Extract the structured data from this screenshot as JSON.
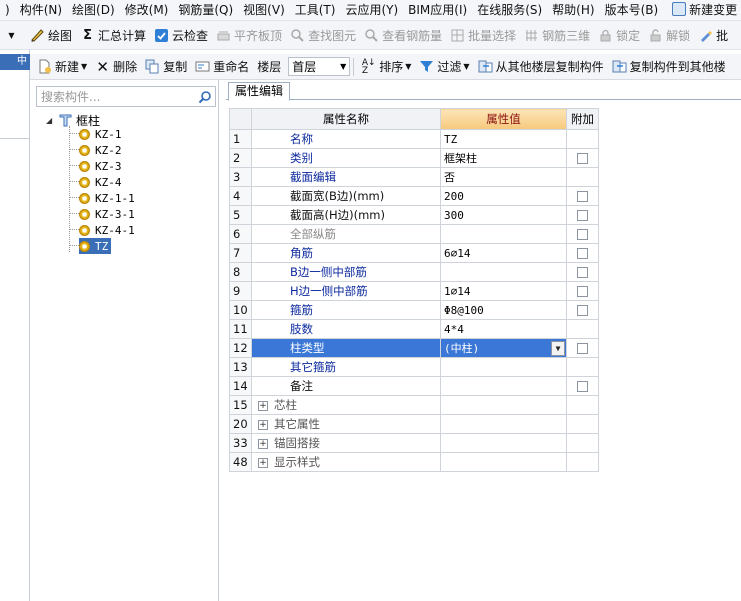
{
  "menubar": {
    "items": [
      ")",
      "构件(N)",
      "绘图(D)",
      "修改(M)",
      "钢筋量(Q)",
      "视图(V)",
      "工具(T)",
      "云应用(Y)",
      "BIM应用(I)",
      "在线服务(S)",
      "帮助(H)",
      "版本号(B)",
      "新建变更"
    ]
  },
  "toolbar1": {
    "draw": "绘图",
    "sum_calc": "汇总计算",
    "cloud_check": "云检查",
    "level_slab": "平齐板顶",
    "find_element": "查找图元",
    "view_rebar": "查看钢筋量",
    "batch_select": "批量选择",
    "rebar_3d": "钢筋三维",
    "lock": "锁定",
    "unlock": "解锁",
    "batch": "批"
  },
  "toolbar2": {
    "new": "新建",
    "delete": "删除",
    "copy": "复制",
    "rename": "重命名",
    "floor_label": "楼层",
    "floor_value": "首层",
    "sort": "排序",
    "filter": "过滤",
    "copy_from_floor": "从其他楼层复制构件",
    "copy_to_floor": "复制构件到其他楼"
  },
  "left_stub": {
    "tab_label": "中"
  },
  "tree": {
    "search_placeholder": "搜索构件...",
    "root_label": "框柱",
    "items": [
      "KZ-1",
      "KZ-2",
      "KZ-3",
      "KZ-4",
      "KZ-1-1",
      "KZ-3-1",
      "KZ-4-1",
      "TZ"
    ],
    "selected_index": 7
  },
  "panel": {
    "tab_label": "属性编辑",
    "col_name": "属性名称",
    "col_value": "属性值",
    "col_extra": "附加"
  },
  "properties": [
    {
      "num": "1",
      "name": "名称",
      "value": "TZ",
      "style": "blue",
      "checkbox": false
    },
    {
      "num": "2",
      "name": "类别",
      "value": "框架柱",
      "style": "blue",
      "checkbox": true
    },
    {
      "num": "3",
      "name": "截面编辑",
      "value": "否",
      "style": "blue",
      "checkbox": false
    },
    {
      "num": "4",
      "name": "截面宽(B边)(mm)",
      "value": "200",
      "style": "black",
      "checkbox": true
    },
    {
      "num": "5",
      "name": "截面高(H边)(mm)",
      "value": "300",
      "style": "black",
      "checkbox": true
    },
    {
      "num": "6",
      "name": "全部纵筋",
      "value": "",
      "style": "gray",
      "checkbox": true
    },
    {
      "num": "7",
      "name": "角筋",
      "value": "6⌀14",
      "style": "blue",
      "checkbox": true
    },
    {
      "num": "8",
      "name": "B边一侧中部筋",
      "value": "",
      "style": "blue",
      "checkbox": true
    },
    {
      "num": "9",
      "name": "H边一侧中部筋",
      "value": "1⌀14",
      "style": "blue",
      "checkbox": true
    },
    {
      "num": "10",
      "name": "箍筋",
      "value": "Φ8@100",
      "style": "blue",
      "checkbox": true
    },
    {
      "num": "11",
      "name": "肢数",
      "value": "4*4",
      "style": "blue",
      "checkbox": false
    },
    {
      "num": "12",
      "name": "柱类型",
      "value": "(中柱)",
      "style": "blue",
      "checkbox": true,
      "selected": true
    },
    {
      "num": "13",
      "name": "其它箍筋",
      "value": "",
      "style": "blue",
      "checkbox": false
    },
    {
      "num": "14",
      "name": "备注",
      "value": "",
      "style": "black",
      "checkbox": true
    }
  ],
  "groups": [
    {
      "num": "15",
      "name": "芯柱"
    },
    {
      "num": "20",
      "name": "其它属性"
    },
    {
      "num": "33",
      "name": "锚固搭接"
    },
    {
      "num": "48",
      "name": "显示样式"
    }
  ]
}
